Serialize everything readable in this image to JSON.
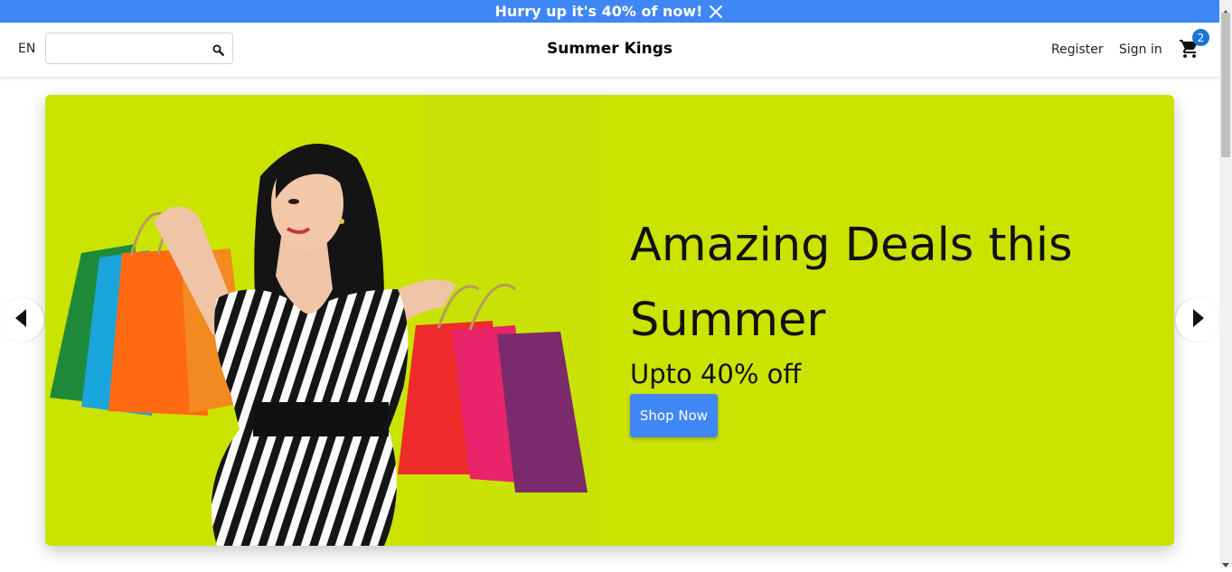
{
  "announcement": {
    "text": "Hurry up it's 40% of now!",
    "close_icon": "close-icon"
  },
  "header": {
    "language": "EN",
    "search": {
      "value": "",
      "placeholder": "",
      "icon": "search-icon"
    },
    "brand": "Summer Kings",
    "register_label": "Register",
    "signin_label": "Sign in",
    "cart": {
      "icon": "cart-icon",
      "count": "2"
    }
  },
  "hero": {
    "title": "Amazing Deals this Summer",
    "subtitle": "Upto 40% off",
    "button_label": "Shop Now",
    "background_color": "#cbe300",
    "prev_icon": "arrow-left-icon",
    "next_icon": "arrow-right-icon"
  },
  "colors": {
    "accent": "#3f87f5",
    "badge": "#1976d2"
  }
}
